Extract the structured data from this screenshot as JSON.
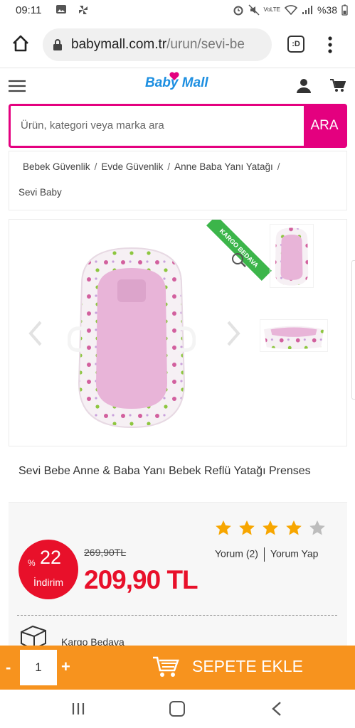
{
  "status_bar": {
    "time": "09:11",
    "battery": "%38"
  },
  "browser": {
    "url_host": "babymall.com.tr",
    "url_path": "/urun/sevi-be",
    "tabs_label": ":D"
  },
  "site": {
    "logo_part1": "Baby",
    "logo_part2": "Mall",
    "brand_color": "#e4007f"
  },
  "search": {
    "placeholder": "Ürün, kategori veya marka ara",
    "button_label": "ARA"
  },
  "breadcrumb": {
    "items": [
      "Bebek Güvenlik",
      "Evde Güvenlik",
      "Anne Baba Yanı Yatağı",
      "Sevi Baby"
    ]
  },
  "gallery": {
    "ribbon": "KARGO BEDAVA"
  },
  "product": {
    "title": "Sevi Bebe Anne & Baba Yanı Bebek Reflü Yatağı Prenses",
    "discount_prefix": "%",
    "discount_value": "22",
    "discount_label": "İndirim",
    "old_price": "269,90TL",
    "new_price": "209,90 TL",
    "rating": 4,
    "rating_max": 5,
    "reviews_label": "Yorum (2)",
    "write_review_label": "Yorum Yap",
    "shipping_label": "Kargo Bedava",
    "price_color": "#e8102a"
  },
  "cart": {
    "minus": "-",
    "quantity": "1",
    "plus": "+",
    "add_label": "SEPETE EKLE",
    "bar_color": "#f7931e"
  }
}
